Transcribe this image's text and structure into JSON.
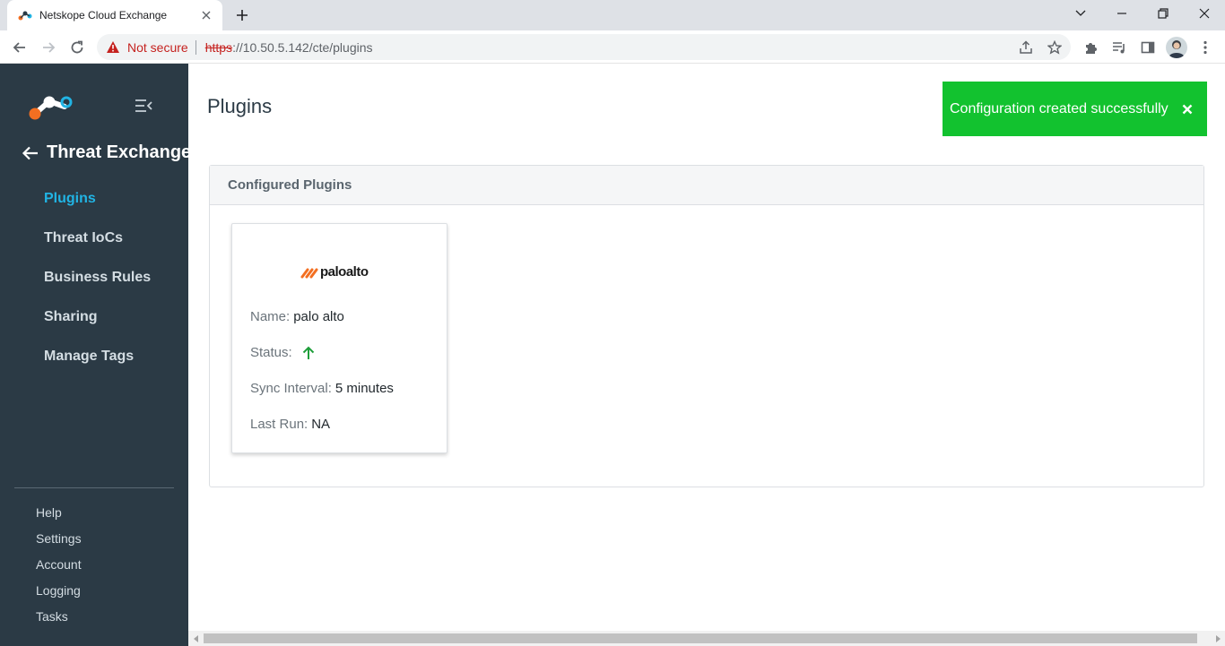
{
  "browser": {
    "tab_title": "Netskope Cloud Exchange",
    "not_secure": "Not secure",
    "url_scheme": "https",
    "url_rest": "://10.50.5.142/cte/plugins"
  },
  "sidebar": {
    "back_label": "Threat Exchange",
    "nav": [
      {
        "label": "Plugins",
        "active": true
      },
      {
        "label": "Threat IoCs"
      },
      {
        "label": "Business Rules"
      },
      {
        "label": "Sharing"
      },
      {
        "label": "Manage Tags"
      }
    ],
    "footer": [
      {
        "label": "Help"
      },
      {
        "label": "Settings"
      },
      {
        "label": "Account"
      },
      {
        "label": "Logging"
      },
      {
        "label": "Tasks"
      }
    ]
  },
  "main": {
    "title": "Plugins",
    "panel_title": "Configured Plugins",
    "plugins": [
      {
        "logo_text": "paloalto",
        "name_label": "Name:",
        "name": "palo alto",
        "status_label": "Status:",
        "status_icon": "arrow-up-icon",
        "sync_label": "Sync Interval:",
        "sync_interval": "5 minutes",
        "last_run_label": "Last Run:",
        "last_run": "NA"
      }
    ]
  },
  "toast": {
    "message": "Configuration created successfully"
  },
  "colors": {
    "sidebar_bg": "#2b3a45",
    "active_nav": "#21b4e4",
    "toast_bg": "#12c22f",
    "status_up": "#1e9e3a",
    "logo_orange": "#f36f21"
  }
}
